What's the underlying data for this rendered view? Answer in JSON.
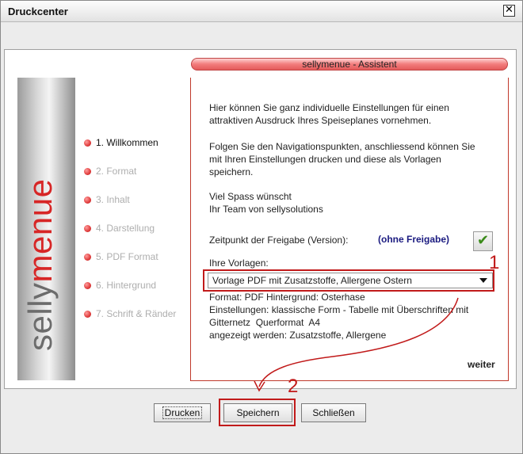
{
  "window": {
    "title": "Druckcenter",
    "close_glyph": "✕"
  },
  "logo": {
    "part1": "selly",
    "part2": "menue"
  },
  "nav": [
    {
      "label": "1. Willkommen",
      "active": true
    },
    {
      "label": "2. Format",
      "active": false
    },
    {
      "label": "3. Inhalt",
      "active": false
    },
    {
      "label": "4. Darstellung",
      "active": false
    },
    {
      "label": "5. PDF Format",
      "active": false
    },
    {
      "label": "6. Hintergrund",
      "active": false
    },
    {
      "label": "7. Schrift & Ränder",
      "active": false
    }
  ],
  "header": {
    "title": "sellymenue - Assistent"
  },
  "intro": {
    "line1": "Hier können Sie ganz individuelle Einstellungen für einen",
    "line2": "attraktiven Ausdruck Ihres Speiseplanes vornehmen.",
    "line3": "Folgen Sie den Navigationspunkten, anschliessend können Sie",
    "line4": "mit Ihren Einstellungen drucken und diese als Vorlagen",
    "line5": "speichern.",
    "line6": "Viel Spass wünscht",
    "line7": "Ihr Team von sellysolutions"
  },
  "release": {
    "label": "Zeitpunkt der Freigabe (Version):",
    "value": "(ohne Freigabe)",
    "confirm_glyph": "✔"
  },
  "templates": {
    "label": "Ihre Vorlagen:",
    "selected": "Vorlage PDF mit Zusatzstoffe, Allergene Ostern",
    "details": [
      "Format: PDF Hintergrund: Osterhase",
      "Einstellungen: klassische Form - Tabelle mit Überschriften mit",
      "Gitternetz  Querformat  A4",
      "angezeigt werden: Zusatzstoffe, Allergene"
    ]
  },
  "next_label": "weiter",
  "buttons": {
    "print": "Drucken",
    "save": "Speichern",
    "close": "Schließen"
  },
  "annotations": {
    "marker1": "1",
    "marker2": "2",
    "color": "#c11a1a"
  },
  "colors": {
    "accent_red": "#d72626",
    "header_pink": "#f27c7c",
    "check_green": "#3a8a1a"
  },
  "icons": {
    "close": "close-icon",
    "confirm": "checkmark-icon",
    "dropdown": "chevron-down-icon",
    "nav_bullet": "red-dot-icon"
  }
}
